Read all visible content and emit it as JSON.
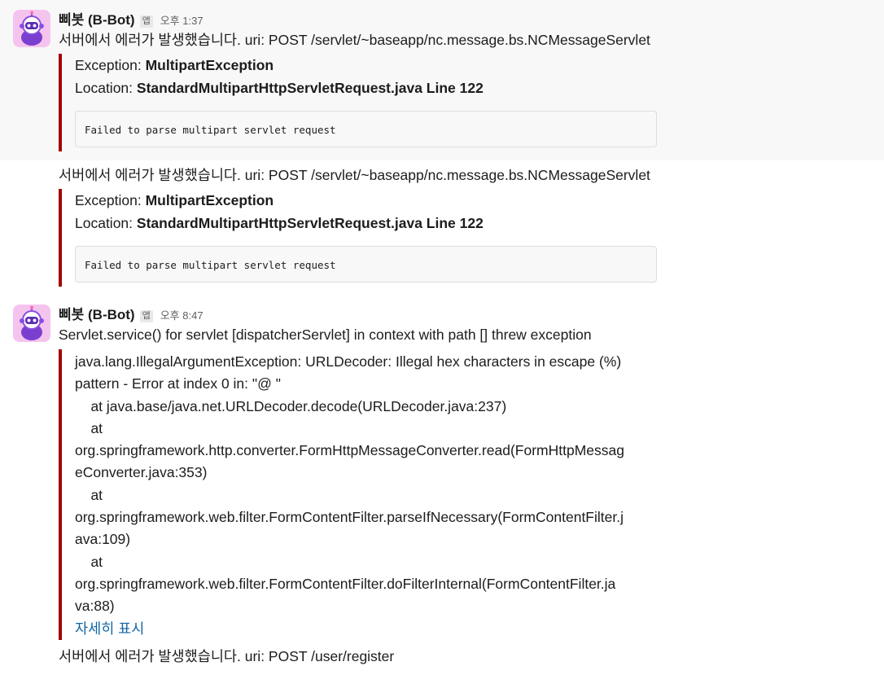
{
  "bot": {
    "name": "삐봇 (B-Bot)",
    "app_badge": "앱",
    "avatar_icon": "robot-avatar-icon"
  },
  "messages": [
    {
      "time": "오후 1:37",
      "text": "서버에서 에러가 발생했습니다. uri: POST /servlet/~baseapp/nc.message.bs.NCMessageServlet",
      "exception_label": "Exception: ",
      "exception_value": "MultipartException",
      "location_label": "Location: ",
      "location_value": "StandardMultipartHttpServletRequest.java Line 122",
      "code": "Failed to parse multipart servlet request"
    },
    {
      "text": "서버에서 에러가 발생했습니다. uri: POST /servlet/~baseapp/nc.message.bs.NCMessageServlet",
      "exception_label": "Exception: ",
      "exception_value": "MultipartException",
      "location_label": "Location: ",
      "location_value": "StandardMultipartHttpServletRequest.java Line 122",
      "code": "Failed to parse multipart servlet request"
    },
    {
      "time": "오후 8:47",
      "text": "Servlet.service() for servlet [dispatcherServlet] in context with path [] threw exception",
      "trace": [
        "java.lang.IllegalArgumentException: URLDecoder: Illegal hex characters in escape (%)",
        "pattern - Error at index 0 in: \"@ \"",
        "    at java.base/java.net.URLDecoder.decode(URLDecoder.java:237)",
        "    at",
        "org.springframework.http.converter.FormHttpMessageConverter.read(FormHttpMessag",
        "eConverter.java:353)",
        "    at",
        "org.springframework.web.filter.FormContentFilter.parseIfNecessary(FormContentFilter.j",
        "ava:109)",
        "    at",
        "org.springframework.web.filter.FormContentFilter.doFilterInternal(FormContentFilter.ja",
        "va:88)"
      ],
      "show_more": "자세히 표시"
    },
    {
      "text": "서버에서 에러가 발생했습니다. uri: POST /user/register"
    }
  ],
  "colors": {
    "attachment_bar": "#a30200",
    "link": "#1264a3",
    "hover_bg": "#f8f8f8"
  }
}
